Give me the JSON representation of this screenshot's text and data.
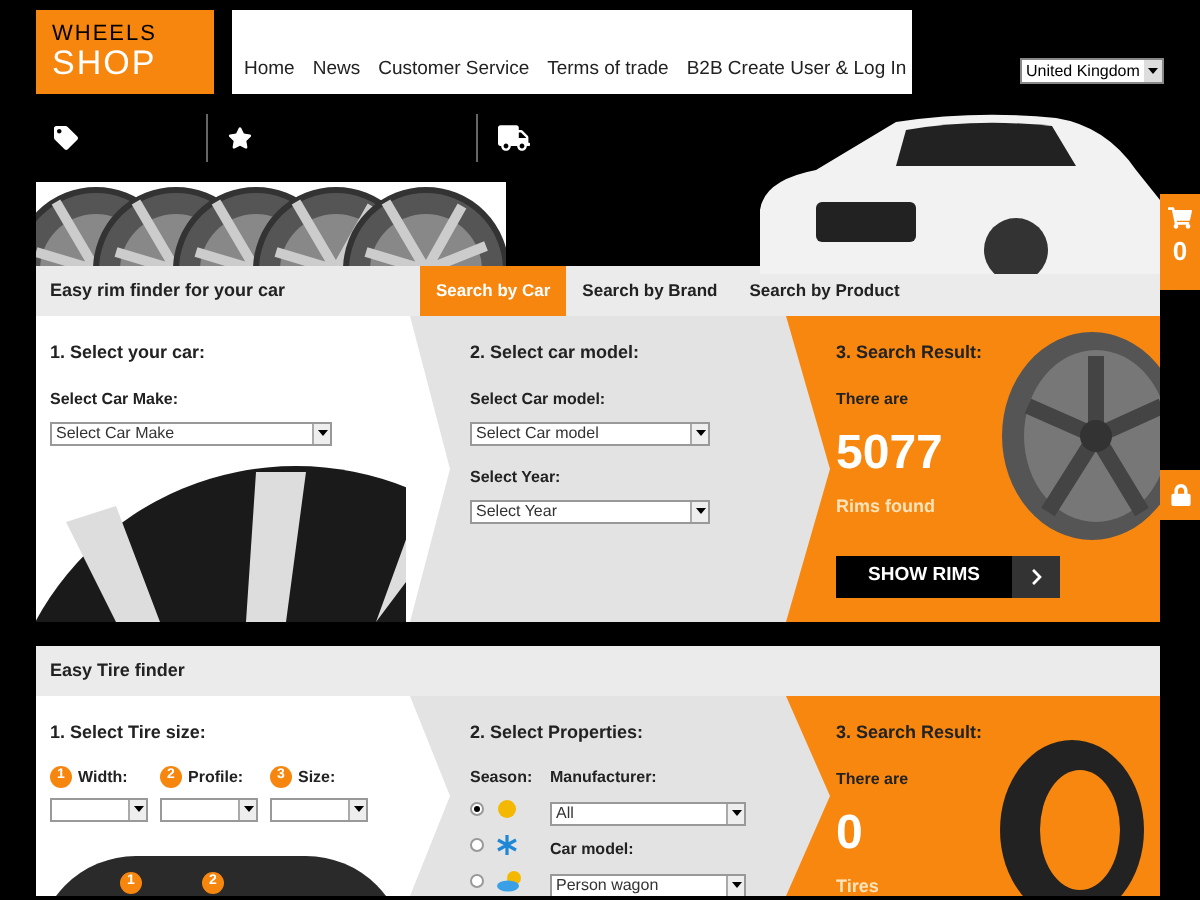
{
  "logo": {
    "lines": [
      "WHEELS",
      "SHOP"
    ]
  },
  "nav": [
    "Home",
    "News",
    "Customer Service",
    "Terms of trade",
    "B2B Create User & Log In"
  ],
  "country_select": {
    "value": "United Kingdom"
  },
  "cart": {
    "count": "0"
  },
  "rim_finder": {
    "title": "Easy rim finder for your car",
    "tabs": [
      {
        "label": "Search by Car",
        "selected": true
      },
      {
        "label": "Search by Brand",
        "selected": false
      },
      {
        "label": "Search by Product",
        "selected": false
      }
    ],
    "step1": {
      "heading": "1. Select your car:",
      "fields": [
        {
          "label": "Select Car Make:",
          "value": "Select Car Make"
        }
      ]
    },
    "step2": {
      "heading": "2. Select car model:",
      "fields": [
        {
          "label": "Select Car model:",
          "value": "Select Car model"
        },
        {
          "label": "Select Year:",
          "value": "Select Year"
        }
      ]
    },
    "result": {
      "heading": "3. Search Result:",
      "intro": "There are",
      "count": "5077",
      "unit": "Rims found",
      "button": "SHOW RIMS"
    }
  },
  "tire_finder": {
    "title": "Easy Tire finder",
    "step1": {
      "heading": "1. Select Tire size:",
      "fields": [
        {
          "number": "1",
          "label": "Width:"
        },
        {
          "number": "2",
          "label": "Profile:"
        },
        {
          "number": "3",
          "label": "Size:"
        }
      ]
    },
    "diagram_markers": [
      "1",
      "2"
    ],
    "step2": {
      "heading": "2. Select Properties:",
      "season_label": "Season:",
      "seasons": [
        {
          "kind": "summer",
          "selected": true
        },
        {
          "kind": "winter",
          "selected": false
        },
        {
          "kind": "all-season",
          "selected": false
        }
      ],
      "fields": [
        {
          "label": "Manufacturer:",
          "value": "All"
        },
        {
          "label": "Car model:",
          "value": "Person wagon"
        }
      ]
    },
    "result": {
      "heading": "3. Search Result:",
      "intro": "There are",
      "count": "0",
      "unit": "Tires"
    }
  }
}
